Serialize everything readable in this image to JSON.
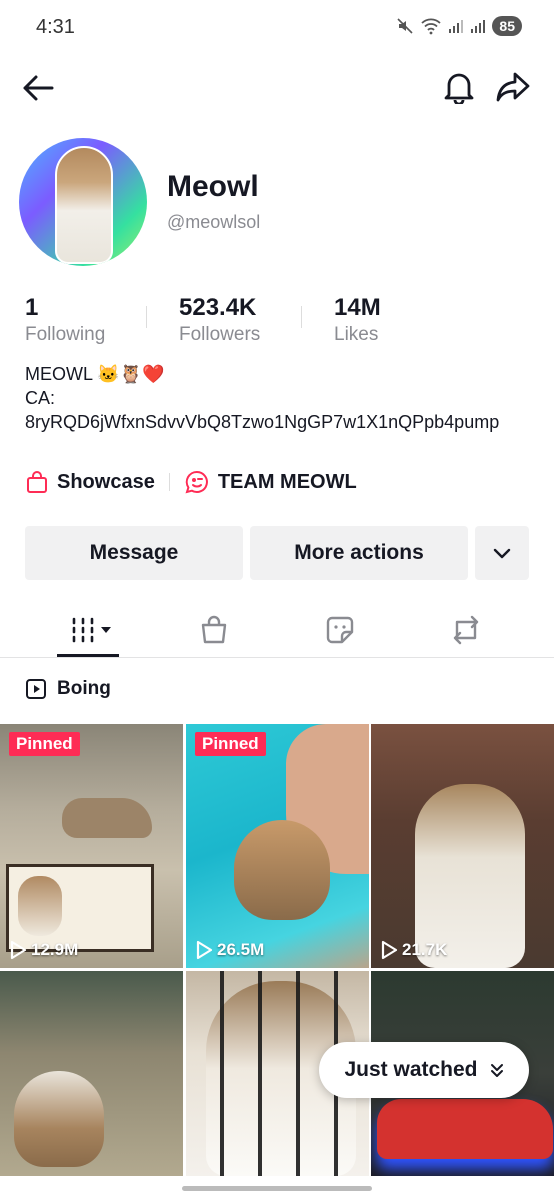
{
  "status": {
    "time": "4:31",
    "battery": "85"
  },
  "header": {
    "back_icon": "arrow-left-icon",
    "bell_icon": "bell-icon",
    "share_icon": "share-arrow-icon"
  },
  "profile": {
    "name": "Meowl",
    "handle": "@meowlsol",
    "stats": [
      {
        "value": "1",
        "label": "Following"
      },
      {
        "value": "523.4K",
        "label": "Followers"
      },
      {
        "value": "14M",
        "label": "Likes"
      }
    ],
    "bio_line1": "MEOWL 🐱🦉❤️",
    "bio_line2": "CA:",
    "bio_line3": "8ryRQD6jWfxnSdvvVbQ8Tzwo1NgGP7w1X1nQPpb4pump",
    "links": [
      {
        "label": "Showcase",
        "icon": "shopping-bag-icon"
      },
      {
        "label": "TEAM MEOWL",
        "icon": "group-chat-icon"
      }
    ]
  },
  "actions": {
    "message": "Message",
    "more": "More actions"
  },
  "tabs": [
    "videos-grid-icon",
    "shop-bag-icon",
    "sticker-icon",
    "repost-icon"
  ],
  "playlist": {
    "label": "Boing"
  },
  "videos": [
    {
      "pinned": "Pinned",
      "views": "12.9M"
    },
    {
      "pinned": "Pinned",
      "views": "26.5M"
    },
    {
      "pinned": "",
      "views": "21.7K"
    },
    {
      "pinned": "",
      "views": ""
    },
    {
      "pinned": "",
      "views": ""
    },
    {
      "pinned": "",
      "views": ""
    }
  ],
  "just_watched": {
    "label": "Just watched"
  },
  "colors": {
    "accent": "#fe2c55",
    "text": "#161823",
    "muted": "#8a8b91",
    "button_bg": "#f1f1f2"
  }
}
